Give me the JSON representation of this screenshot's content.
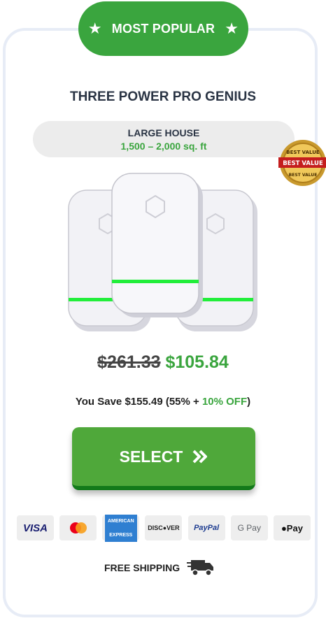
{
  "badge": {
    "label": "MOST POPULAR",
    "star_icon": "star-icon"
  },
  "product": {
    "title": "THREE POWER PRO GENIUS",
    "house_size": "LARGE HOUSE",
    "area": "1,500 – 2,000 sq. ft",
    "seal_top": "BEST VALUE",
    "seal_middle": "BEST VALUE",
    "seal_bottom": "BEST VALUE"
  },
  "pricing": {
    "old_price": "$261.33",
    "new_price": "$105.84",
    "save_prefix": "You Save $155.49 (55% + ",
    "save_off": "10% OFF",
    "save_suffix": ")"
  },
  "select_button": {
    "label": "SELECT",
    "icon": "double-chevron-right-icon"
  },
  "payments": {
    "visa": "VISA",
    "amex_1": "AMERICAN",
    "amex_2": "EXPRESS",
    "discover": "DISC●VER",
    "paypal": "PayPal",
    "gpay": "G Pay",
    "apay": "Pay"
  },
  "shipping": {
    "label": "FREE SHIPPING",
    "icon": "truck-icon"
  },
  "colors": {
    "accent": "#3aa53e",
    "button": "#4fa83a",
    "button_edge": "#137a1a",
    "card_border": "#e7ecf6",
    "glow": "#22ee3a"
  }
}
